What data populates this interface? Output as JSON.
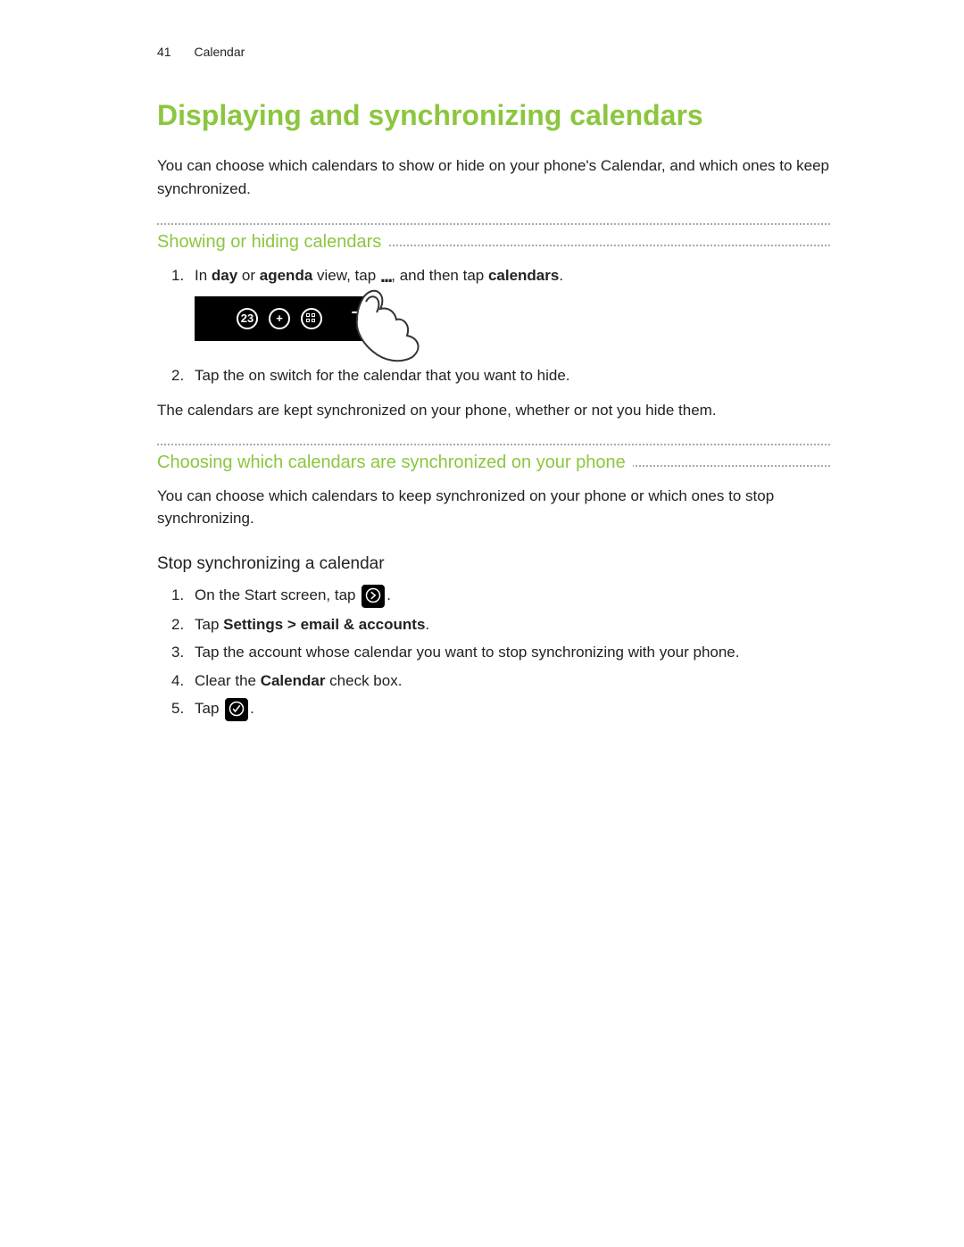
{
  "header": {
    "page": "41",
    "section": "Calendar"
  },
  "title": "Displaying and synchronizing calendars",
  "intro": "You can choose which calendars to show or hide on your phone's Calendar, and which ones to keep synchronized.",
  "sec1": {
    "heading": "Showing or hiding calendars",
    "step1": {
      "t1": "In ",
      "b1": "day",
      "t2": " or ",
      "b2": "agenda",
      "t3": " view, tap ",
      "dots": "...",
      "t4": ", and then tap ",
      "b3": "calendars",
      "t5": "."
    },
    "step2": "Tap the on switch for the calendar that you want to hide.",
    "after": "The calendars are kept synchronized on your phone, whether or not you hide them."
  },
  "sec2": {
    "heading": "Choosing which calendars are synchronized on your phone",
    "intro": "You can choose which calendars to keep synchronized on your phone or which ones to stop synchronizing.",
    "sub": "Stop synchronizing a calendar",
    "s1": {
      "t1": "On the Start screen, tap ",
      "t2": "."
    },
    "s2": {
      "t1": "Tap ",
      "b1": "Settings > email & accounts",
      "t2": "."
    },
    "s3": "Tap the account whose calendar you want to stop synchronizing with your phone.",
    "s4": {
      "t1": "Clear the ",
      "b1": "Calendar",
      "t2": " check box."
    },
    "s5": {
      "t1": "Tap ",
      "t2": "."
    }
  },
  "nums": {
    "n1": "1.",
    "n2": "2.",
    "n3": "3.",
    "n4": "4.",
    "n5": "5."
  },
  "icons": {
    "appbar_today": "23",
    "appbar_plus": "+",
    "more": "...",
    "arrow": "arrow-icon",
    "check": "check-icon"
  }
}
